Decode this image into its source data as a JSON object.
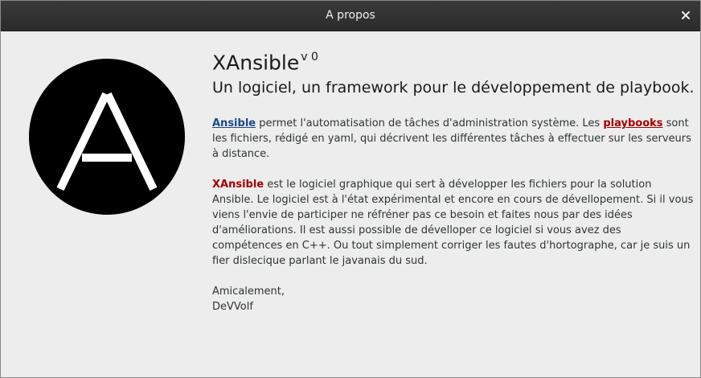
{
  "window": {
    "title": "A propos"
  },
  "icons": {
    "close": "close-icon",
    "logo": "ansible-logo-icon"
  },
  "colors": {
    "link_blue": "#204a87",
    "link_red": "#a40000",
    "titlebar": "#2d2d2d",
    "logo": "#000000"
  },
  "header": {
    "app_name": "XAnsible",
    "version": "v 0",
    "tagline": "Un logiciel, un framework pour le développement de playbook."
  },
  "para1": {
    "link1": "Ansible",
    "text1": " permet l'automatisation de tâches d'administration système. Les ",
    "link2": "playbooks",
    "text2": " sont les fichiers, rédigé en yaml, qui décrivent les différentes tâches à effectuer sur les serveurs à distance."
  },
  "para2": {
    "name": "XAnsible",
    "text": " est le logiciel graphique qui sert à développer les fichiers pour la solution Ansible. Le logiciel est à l'état expérimental et encore en cours de dévellopement. Si il vous viens l'envie de participer ne réfréner pas ce besoin et faites nous par des idées d'améliorations. Il est aussi possible de dévelloper ce logiciel si vous avez des compétences en C++. Ou tout simplement corriger les fautes d'hortographe, car je suis un fier dislecique parlant le javanais du sud."
  },
  "signature": {
    "closing": "Amicalement,",
    "author": "DeVVolf"
  }
}
